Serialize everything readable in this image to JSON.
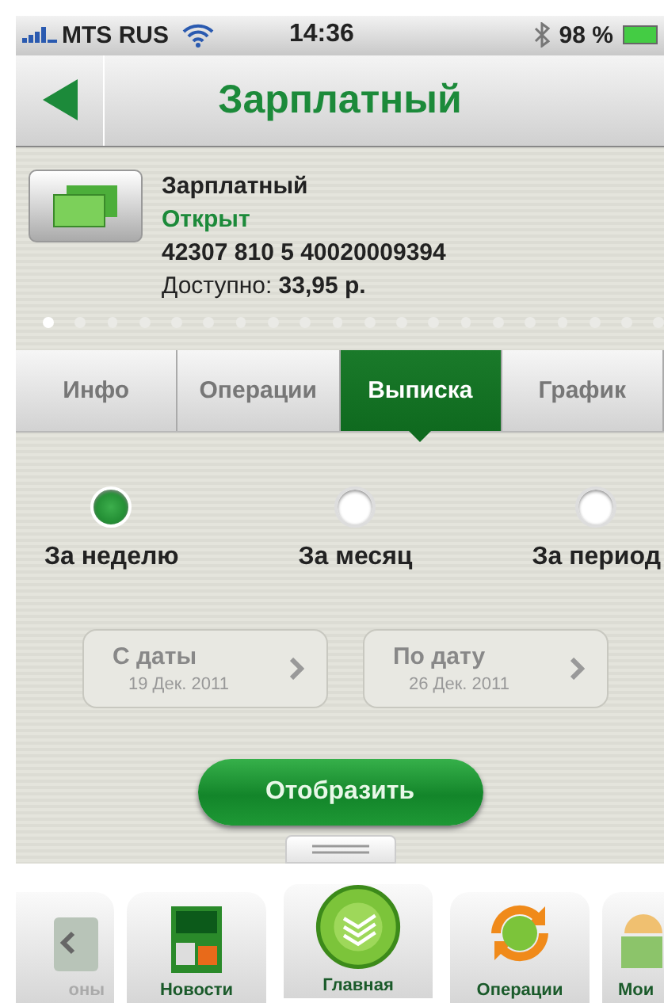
{
  "status_bar": {
    "carrier": "MTS RUS",
    "time": "14:36",
    "battery": "98 %"
  },
  "nav_bar": {
    "title": "Зарплатный"
  },
  "account": {
    "name": "Зарплатный",
    "status": "Открыт",
    "number": "42307 810 5 40020009394",
    "available_label": "Доступно:",
    "available_value": "33,95 р."
  },
  "page_dots": [
    {
      "selected": true
    },
    {
      "selected": false
    },
    {
      "selected": false
    },
    {
      "selected": false
    },
    {
      "selected": false
    },
    {
      "selected": false
    },
    {
      "selected": false
    },
    {
      "selected": false
    },
    {
      "selected": false
    },
    {
      "selected": false
    },
    {
      "selected": false
    },
    {
      "selected": false
    },
    {
      "selected": false
    },
    {
      "selected": false
    },
    {
      "selected": false
    },
    {
      "selected": false
    },
    {
      "selected": false
    },
    {
      "selected": false
    },
    {
      "selected": false
    },
    {
      "selected": false
    }
  ],
  "tabs": [
    {
      "label": "Инфо",
      "selected": false
    },
    {
      "label": "Операции",
      "selected": false
    },
    {
      "label": "Выписка",
      "selected": true
    },
    {
      "label": "График",
      "selected": false
    }
  ],
  "periods": [
    {
      "label": "За неделю",
      "selected": true
    },
    {
      "label": "За месяц",
      "selected": false
    },
    {
      "label": "За период",
      "selected": false
    }
  ],
  "date_buttons": [
    {
      "label": "С даты",
      "value": "19 Дек. 2011"
    },
    {
      "label": "По дату",
      "value": "26 Дек. 2011"
    }
  ],
  "show_button": "Отобразить",
  "tab_bar": [
    {
      "label": "оны",
      "kind": "templates",
      "selected": false
    },
    {
      "label": "Новости",
      "kind": "news",
      "selected": false
    },
    {
      "label": "Главная",
      "kind": "home",
      "selected": true
    },
    {
      "label": "Операции",
      "kind": "operations",
      "selected": false
    },
    {
      "label": "Мои",
      "kind": "mine",
      "selected": false
    }
  ]
}
